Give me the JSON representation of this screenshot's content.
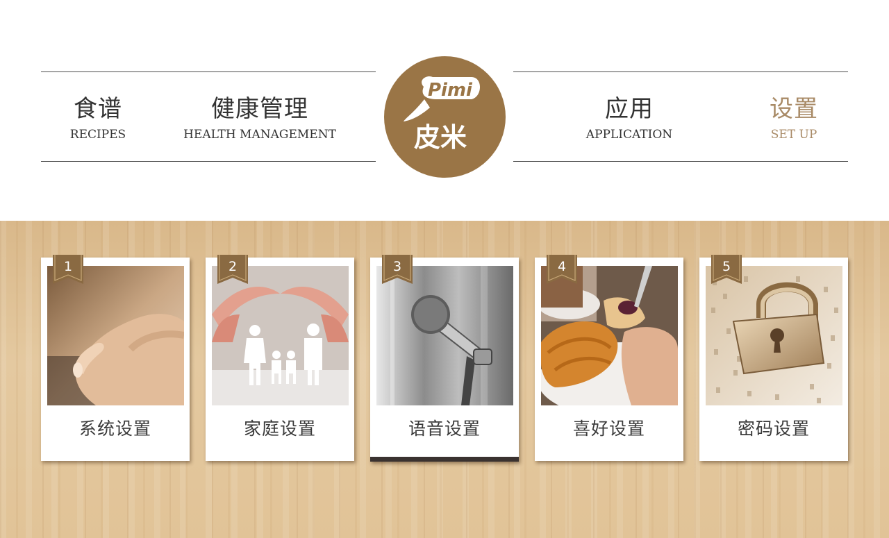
{
  "nav": {
    "left": [
      {
        "cn": "食谱",
        "en": "RECIPES"
      },
      {
        "cn": "健康管理",
        "en": "HEALTH  MANAGEMENT"
      }
    ],
    "right": [
      {
        "cn": "应用",
        "en": "APPLICATION"
      },
      {
        "cn": "设置",
        "en": "SET UP",
        "active": true
      }
    ]
  },
  "logo": {
    "latin": "Pimi",
    "cn": "皮米"
  },
  "colors": {
    "brand": "#9a7546",
    "active_nav": "#a88a66",
    "selected_bar": "#3a3230",
    "badge": "#8a6a42"
  },
  "settings": [
    {
      "num": "1",
      "label": "系统设置",
      "icon": "touchscreen-hand-photo"
    },
    {
      "num": "2",
      "label": "家庭设置",
      "icon": "family-hands-photo"
    },
    {
      "num": "3",
      "label": "语音设置",
      "icon": "microphone-photo",
      "selected": true
    },
    {
      "num": "4",
      "label": "喜好设置",
      "icon": "breakfast-photo"
    },
    {
      "num": "5",
      "label": "密码设置",
      "icon": "padlock-photo"
    }
  ]
}
